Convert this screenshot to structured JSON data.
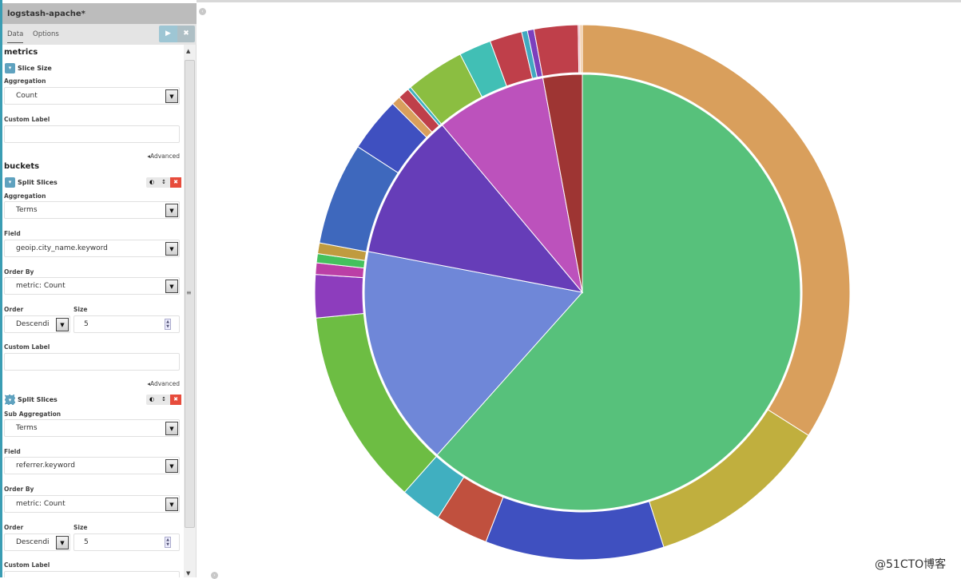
{
  "window": {
    "title": "logstash-apache*"
  },
  "tabs": [
    {
      "label": "Data",
      "active": true
    },
    {
      "label": "Options",
      "active": false
    }
  ],
  "buttons": {
    "apply": "▶",
    "discard": "✖"
  },
  "metrics": {
    "heading": "metrics",
    "slice_size": {
      "title": "Slice Size",
      "aggregation_label": "Aggregation",
      "aggregation": "Count",
      "custom_label_label": "Custom Label",
      "custom_label": ""
    },
    "advanced": "Advanced"
  },
  "buckets": {
    "heading": "buckets",
    "split1": {
      "title": "Split Slices",
      "aggregation_label": "Aggregation",
      "aggregation": "Terms",
      "field_label": "Field",
      "field": "geoip.city_name.keyword",
      "order_by_label": "Order By",
      "order_by": "metric: Count",
      "order_label": "Order",
      "order": "Descendi",
      "size_label": "Size",
      "size": "5",
      "custom_label_label": "Custom Label",
      "custom_label": "",
      "advanced": "Advanced"
    },
    "split2": {
      "title": "Split Slices",
      "aggregation_label": "Sub Aggregation",
      "aggregation": "Terms",
      "field_label": "Field",
      "field": "referrer.keyword",
      "order_by_label": "Order By",
      "order_by": "metric: Count",
      "order_label": "Order",
      "order": "Descendi",
      "size_label": "Size",
      "size": "5",
      "custom_label_label": "Custom Label"
    }
  },
  "watermark": "@51CTO博客",
  "chart_data": {
    "type": "pie",
    "donut": false,
    "legend": "none",
    "inner": {
      "values": [
        61.6,
        16.4,
        10.9,
        8.2,
        2.9
      ],
      "colors": [
        "#57c17b",
        "#6f87d8",
        "#663db8",
        "#bc52bc",
        "#9e3533"
      ]
    },
    "outer": {
      "values": [
        34.0,
        11.1,
        10.8,
        3.2,
        2.5,
        11.9,
        2.6,
        0.7,
        0.55,
        0.65,
        6.2,
        3.3,
        0.55,
        0.7,
        0.2,
        3.55,
        1.95,
        1.95,
        0.35,
        0.4,
        2.65,
        0.1,
        0.15
      ],
      "colors": [
        "#d99f5c",
        "#c0af3e",
        "#3f50c0",
        "#c0503e",
        "#40afc0",
        "#6dbd43",
        "#8d3dbd",
        "#bb3fa6",
        "#44c15d",
        "#c09b3f",
        "#3e68bd",
        "#3f50c0",
        "#d99f5c",
        "#bf3f4a",
        "#40b0c0",
        "#8bbe41",
        "#41bfb5",
        "#bf3f4a",
        "#41a8c0",
        "#7c3fbd",
        "#bf3f4a",
        "#e6a0b0",
        "#f0c8a0"
      ]
    }
  }
}
